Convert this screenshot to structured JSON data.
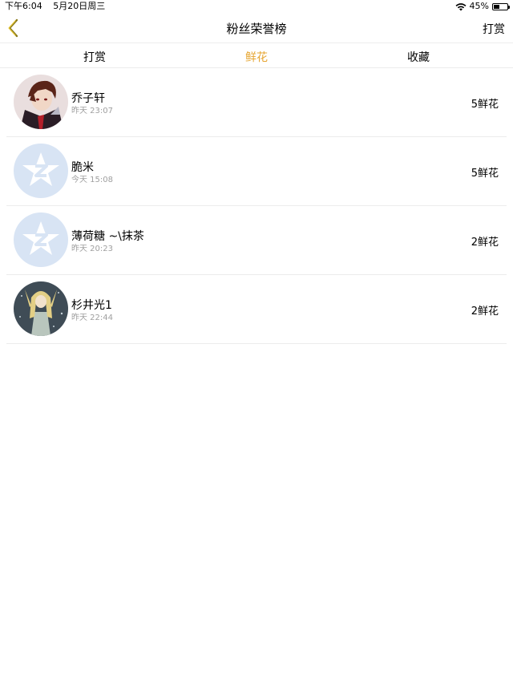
{
  "status_bar": {
    "time": "下午6:04",
    "date": "5月20日周三",
    "battery_text": "45%",
    "battery_level": 0.45
  },
  "nav": {
    "title": "粉丝荣誉榜",
    "action_label": "打赏"
  },
  "tabs": [
    {
      "label": "打赏",
      "active": false
    },
    {
      "label": "鲜花",
      "active": true
    },
    {
      "label": "收藏",
      "active": false
    }
  ],
  "accent_color": "#e6a531",
  "rows": [
    {
      "name": "乔子轩",
      "time": "昨天 23:07",
      "count": "5鲜花",
      "avatar": "anime-boy-avatar"
    },
    {
      "name": "脆米",
      "time": "今天 15:08",
      "count": "5鲜花",
      "avatar": "default-avatar"
    },
    {
      "name": "薄荷糖 ~\\抹茶",
      "time": "昨天 20:23",
      "count": "2鲜花",
      "avatar": "default-avatar"
    },
    {
      "name": "杉井光1",
      "time": "昨天 22:44",
      "count": "2鲜花",
      "avatar": "anime-girl-avatar"
    }
  ]
}
